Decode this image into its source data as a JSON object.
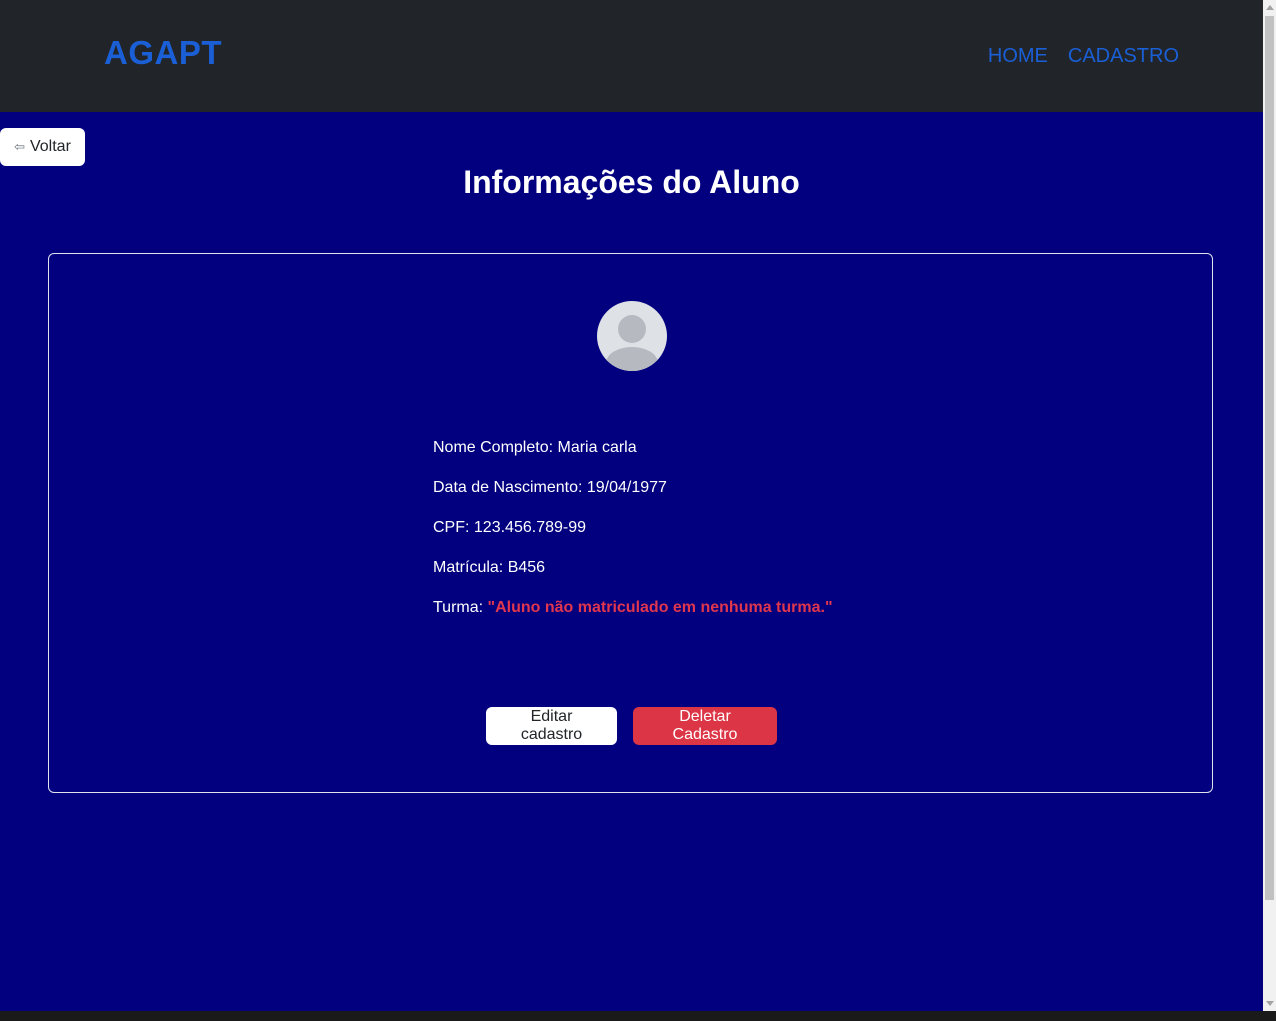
{
  "navbar": {
    "brand": "AGAPT",
    "links": [
      "HOME",
      "CADASTRO"
    ],
    "link_color": "#1a5fd6"
  },
  "back_button": {
    "label": "Voltar",
    "icon": "left-arrow-icon"
  },
  "page": {
    "title": "Informações do Aluno"
  },
  "student": {
    "avatar_icon": "user-avatar-icon",
    "fields": [
      {
        "label": "Nome Completo:",
        "value": "Maria carla"
      },
      {
        "label": "Data de Nascimento:",
        "value": "19/04/1977"
      },
      {
        "label": "CPF:",
        "value": "123.456.789-99"
      },
      {
        "label": "Matrícula:",
        "value": "B456"
      }
    ],
    "turma_label": "Turma:",
    "turma_value": "\"Aluno não matriculado em nenhuma turma.\""
  },
  "actions": {
    "edit_label": "Editar cadastro",
    "delete_label": "Deletar Cadastro"
  },
  "colors": {
    "background": "#02007e",
    "navbar": "#212529",
    "danger": "#dc3545"
  }
}
